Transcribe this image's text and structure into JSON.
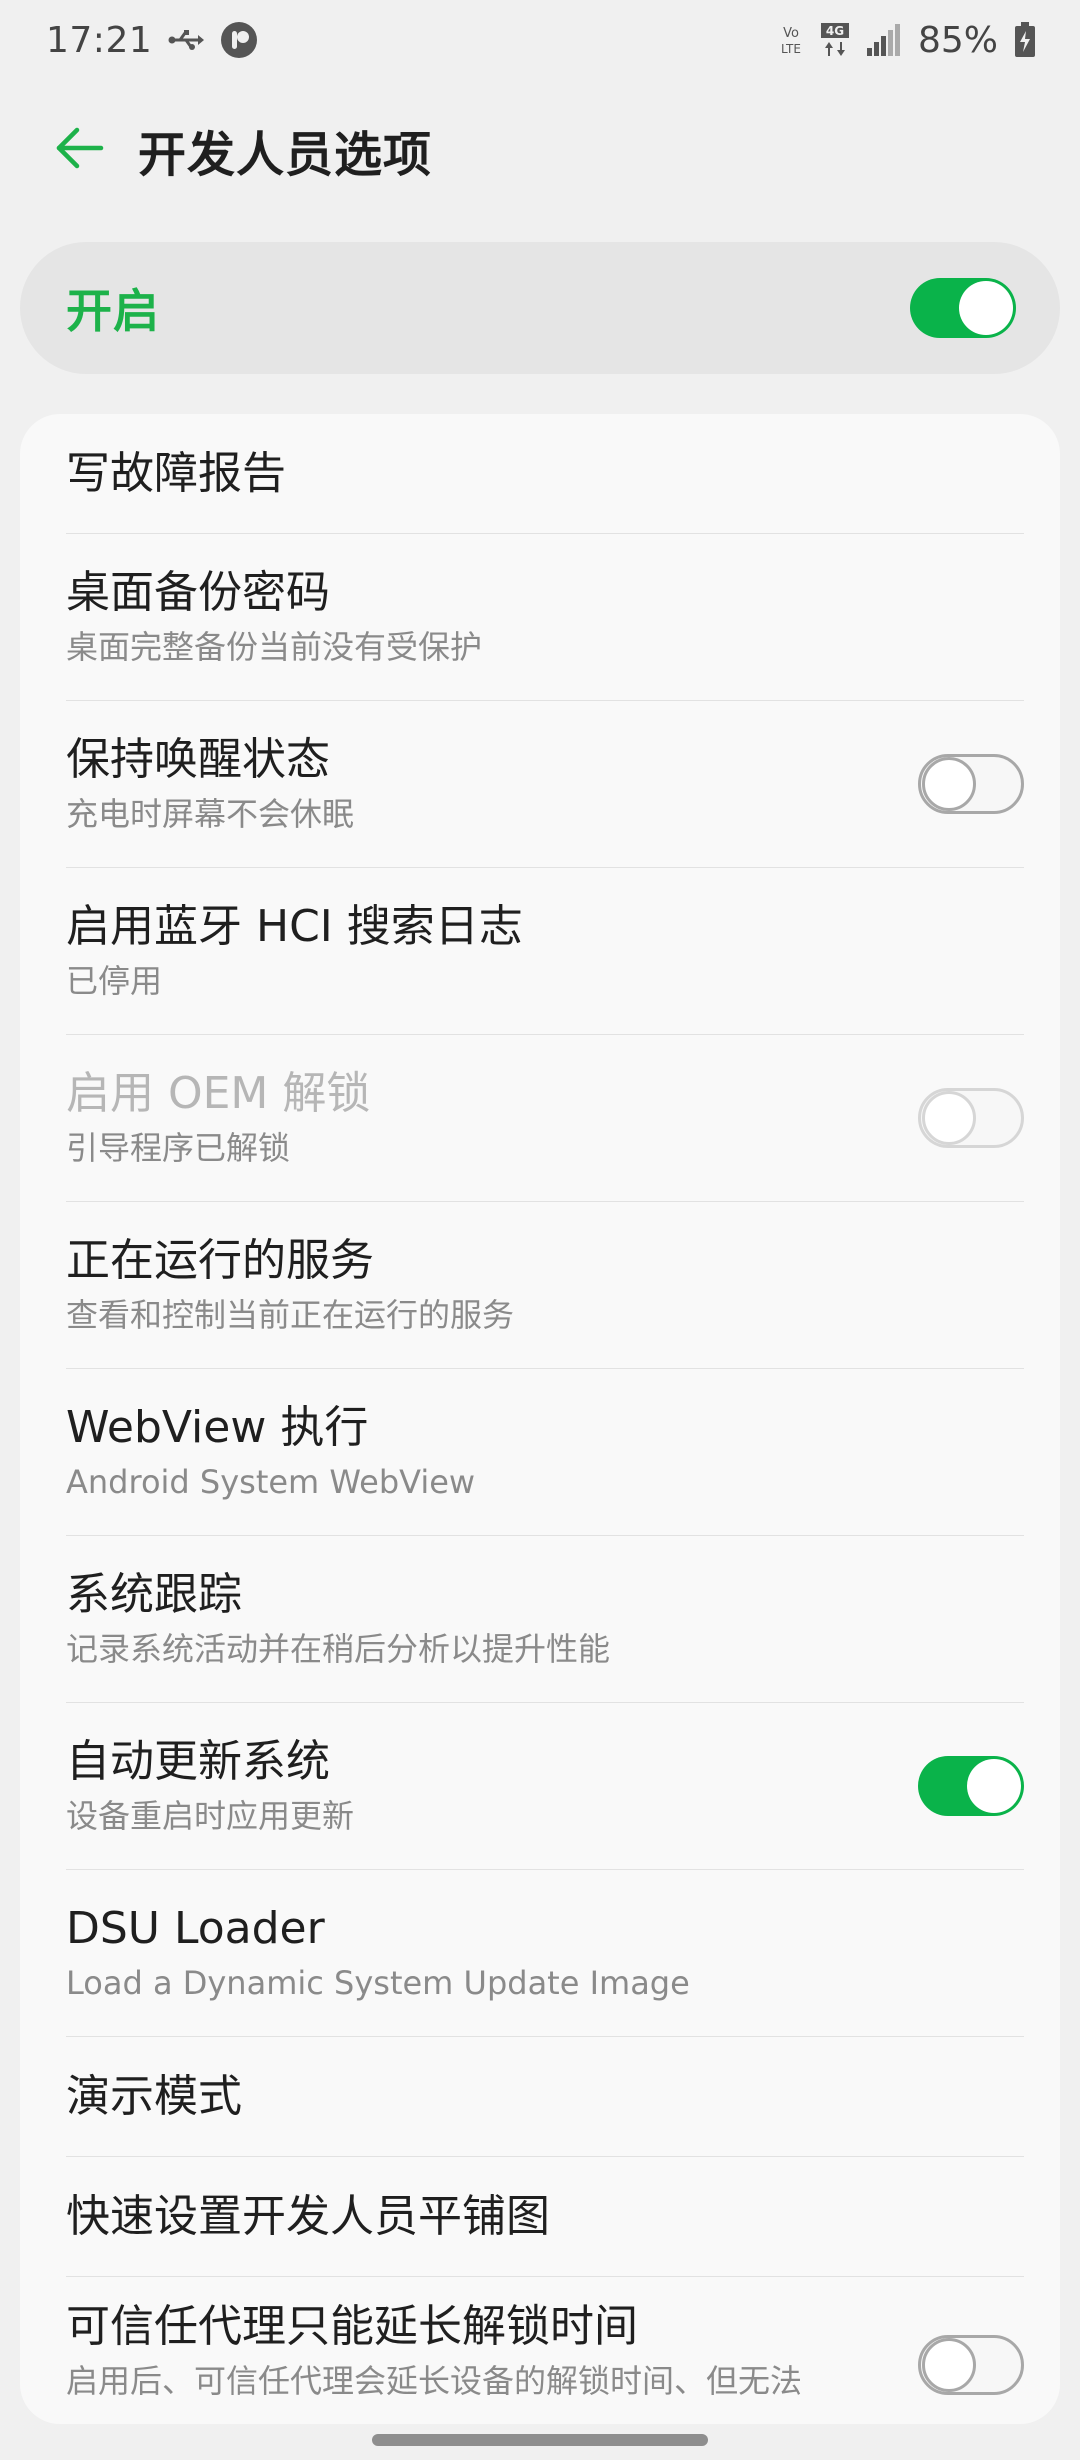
{
  "status_bar": {
    "time": "17:21",
    "battery_percent": "85%",
    "icons": [
      "usb-icon",
      "app-notification-icon",
      "volte-icon",
      "4g-data-icon",
      "signal-icon",
      "battery-icon"
    ]
  },
  "header": {
    "title": "开发人员选项",
    "back_icon": "arrow-left-icon"
  },
  "master_switch": {
    "label": "开启",
    "on": true
  },
  "colors": {
    "accent": "#0ab34a",
    "accent_text": "#1db24a"
  },
  "settings": [
    {
      "title": "写故障报告",
      "subtitle": "",
      "toggle": null
    },
    {
      "title": "桌面备份密码",
      "subtitle": "桌面完整备份当前没有受保护",
      "toggle": null
    },
    {
      "title": "保持唤醒状态",
      "subtitle": "充电时屏幕不会休眠",
      "toggle": "off"
    },
    {
      "title": "启用蓝牙 HCI 搜索日志",
      "subtitle": "已停用",
      "toggle": null
    },
    {
      "title": "启用 OEM 解锁",
      "subtitle": "引导程序已解锁",
      "toggle": "off",
      "disabled": true
    },
    {
      "title": "正在运行的服务",
      "subtitle": "查看和控制当前正在运行的服务",
      "toggle": null
    },
    {
      "title": "WebView 执行",
      "subtitle": "Android System WebView",
      "toggle": null
    },
    {
      "title": "系统跟踪",
      "subtitle": "记录系统活动并在稍后分析以提升性能",
      "toggle": null
    },
    {
      "title": "自动更新系统",
      "subtitle": "设备重启时应用更新",
      "toggle": "on"
    },
    {
      "title": "DSU Loader",
      "subtitle": "Load a Dynamic System Update Image",
      "toggle": null
    },
    {
      "title": "演示模式",
      "subtitle": "",
      "toggle": null
    },
    {
      "title": "快速设置开发人员平铺图",
      "subtitle": "",
      "toggle": null
    },
    {
      "title": "可信任代理只能延长解锁时间",
      "subtitle": "启用后、可信任代理会延长设备的解锁时间、但无法",
      "toggle": "off"
    }
  ]
}
